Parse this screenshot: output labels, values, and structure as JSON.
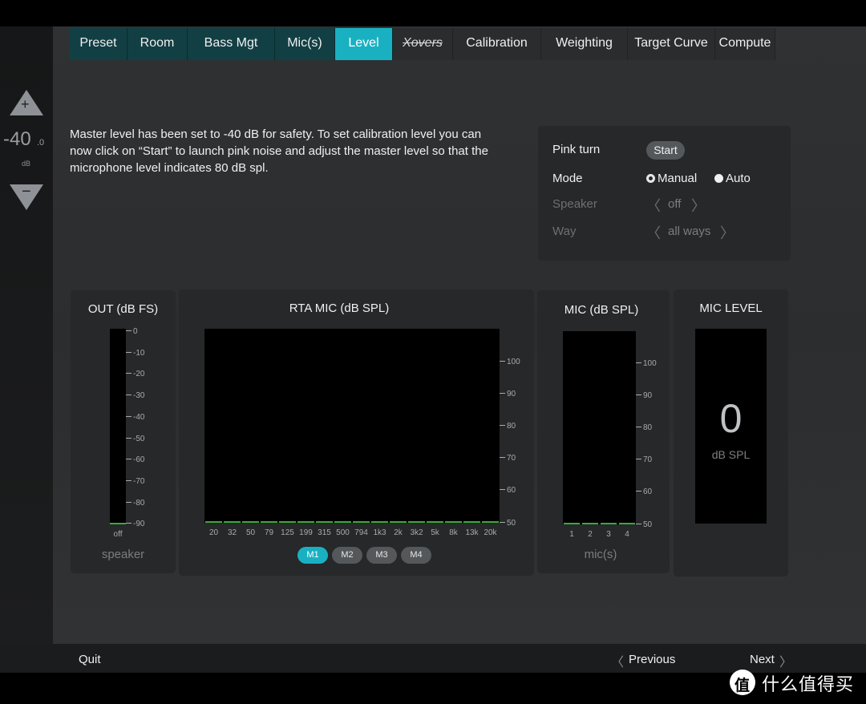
{
  "tabs": [
    {
      "label": "Preset",
      "width": 72,
      "style": "teal"
    },
    {
      "label": "Room",
      "width": 75,
      "style": "teal"
    },
    {
      "label": "Bass Mgt",
      "width": 109,
      "style": "teal"
    },
    {
      "label": "Mic(s)",
      "width": 75,
      "style": "teal"
    },
    {
      "label": "Level",
      "width": 72,
      "style": "active"
    },
    {
      "label": "Xovers",
      "width": 75,
      "style": "strike"
    },
    {
      "label": "Calibration",
      "width": 110,
      "style": "dark"
    },
    {
      "label": "Weighting",
      "width": 108,
      "style": "dark"
    },
    {
      "label": "Target Curve",
      "width": 109,
      "style": "dark"
    },
    {
      "label": "Compute",
      "width": 75,
      "style": "dark"
    }
  ],
  "master": {
    "plus": "+",
    "minus": "−",
    "value": "-40",
    "decimal": ".0",
    "unit": "dB"
  },
  "info_text": "Master level has been set to -40 dB for safety. To set calibration level you can now click on “Start” to launch pink noise and adjust the master level so that the microphone level indicates 80 dB spl.",
  "pink": {
    "pink_turn_label": "Pink turn",
    "start_label": "Start",
    "mode_label": "Mode",
    "manual_label": "Manual",
    "auto_label": "Auto",
    "speaker_label": "Speaker",
    "speaker_value": "off",
    "way_label": "Way",
    "way_value": "all ways"
  },
  "out_meter": {
    "title": "OUT (dB FS)",
    "ticks": [
      "0",
      "-10",
      "-20",
      "-30",
      "-40",
      "-50",
      "-60",
      "-70",
      "-80",
      "-90"
    ],
    "bottom_label": "off",
    "sub": "speaker"
  },
  "rta": {
    "title": "RTA MIC (dB SPL)",
    "ticks": [
      "100",
      "90",
      "80",
      "70",
      "60",
      "50"
    ],
    "bands": [
      "20",
      "32",
      "50",
      "79",
      "125",
      "199",
      "315",
      "500",
      "794",
      "1k3",
      "2k",
      "3k2",
      "5k",
      "8k",
      "13k",
      "20k"
    ],
    "buttons": [
      "M1",
      "M2",
      "M3",
      "M4"
    ]
  },
  "mic_meter": {
    "title": "MIC (dB SPL)",
    "ticks": [
      "100",
      "90",
      "80",
      "70",
      "60",
      "50"
    ],
    "channels": [
      "1",
      "2",
      "3",
      "4"
    ],
    "sub": "mic(s)"
  },
  "mic_level": {
    "title": "MIC LEVEL",
    "value": "0",
    "unit": "dB SPL"
  },
  "footer": {
    "quit": "Quit",
    "previous": "Previous",
    "next": "Next",
    "logo_text": "什么值得买",
    "left_chev": "〈",
    "right_chev": "〉"
  }
}
